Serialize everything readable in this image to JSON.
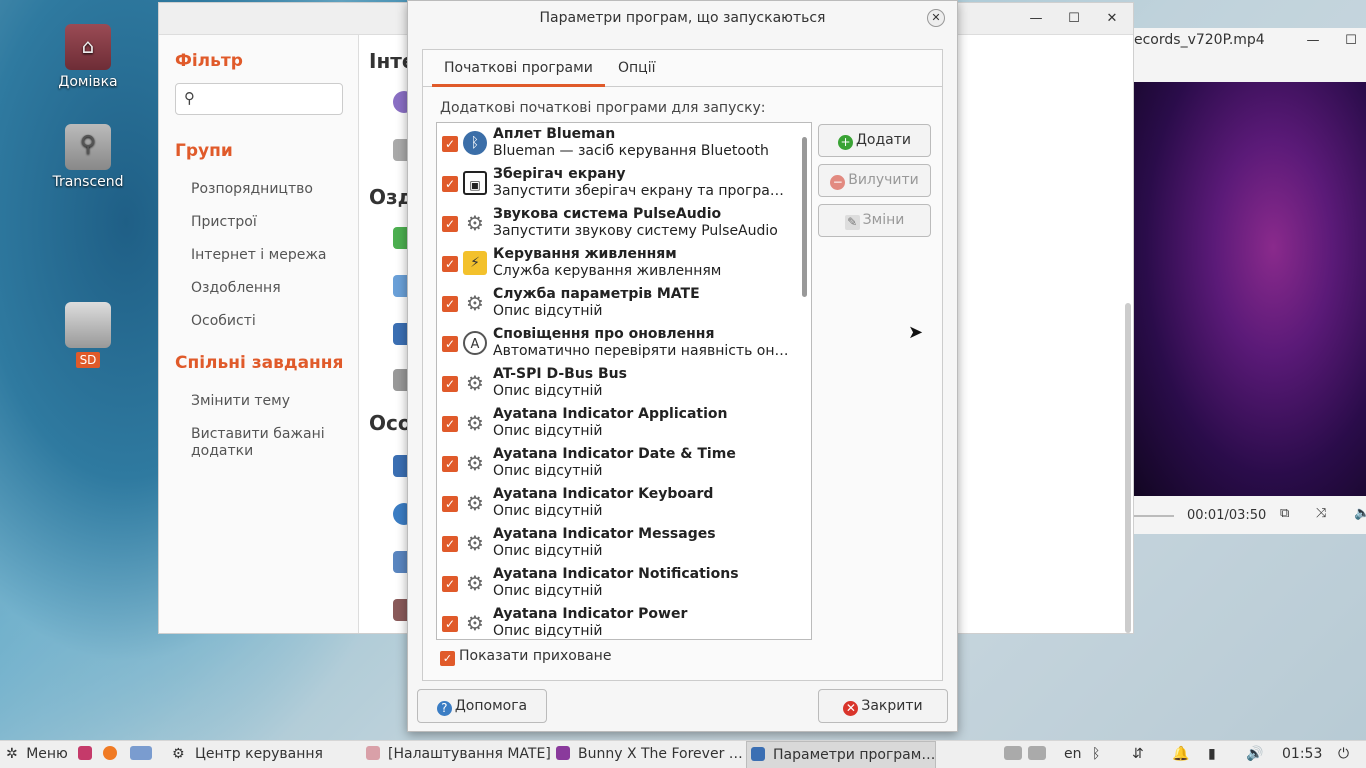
{
  "desktop": {
    "icons": [
      {
        "label": "Домівка"
      },
      {
        "label": "Transcend"
      },
      {
        "label": "SD"
      }
    ]
  },
  "control_center": {
    "filter_heading": "Фільтр",
    "groups_heading": "Групи",
    "groups": [
      "Розпорядництво",
      "Пристрої",
      "Інтернет і мережа",
      "Оздоблення",
      "Особисті"
    ],
    "tasks_heading": "Спільні завдання",
    "tasks": [
      "Змінити тему",
      "Виставити бажані додатки"
    ],
    "sections": [
      "Інте",
      "Озд",
      "Осо"
    ]
  },
  "video_player": {
    "title": "ecords_v720P.mp4",
    "time": "00:01/03:50"
  },
  "dialog": {
    "title": "Параметри програм, що запускаються",
    "tabs": [
      "Початкові програми",
      "Опції"
    ],
    "list_label": "Додаткові початкові програми для запуску:",
    "items": [
      {
        "name": "Аплет Blueman",
        "desc": "Blueman — засіб керування Bluetooth",
        "icon": "bluetooth-icon",
        "checked": true
      },
      {
        "name": "Зберігач екрану",
        "desc": "Запустити зберігач екрану та програму б…",
        "icon": "screensaver-icon",
        "checked": true
      },
      {
        "name": "Звукова система PulseAudio",
        "desc": "Запустити звукову систему PulseAudio",
        "icon": "gears-icon",
        "checked": true
      },
      {
        "name": "Керування живленням",
        "desc": "Служба керування живленням",
        "icon": "power-icon",
        "checked": true
      },
      {
        "name": "Служба параметрів MATE",
        "desc": "Опис відсутній",
        "icon": "gears-icon",
        "checked": true
      },
      {
        "name": "Сповіщення про оновлення",
        "desc": "Автоматично перевіряти наявність онов…",
        "icon": "update-icon",
        "checked": true
      },
      {
        "name": "AT-SPI D-Bus Bus",
        "desc": "Опис відсутній",
        "icon": "gears-icon",
        "checked": true
      },
      {
        "name": "Ayatana Indicator Application",
        "desc": "Опис відсутній",
        "icon": "gears-icon",
        "checked": true
      },
      {
        "name": "Ayatana Indicator Date & Time",
        "desc": "Опис відсутній",
        "icon": "gears-icon",
        "checked": true
      },
      {
        "name": "Ayatana Indicator Keyboard",
        "desc": "Опис відсутній",
        "icon": "gears-icon",
        "checked": true
      },
      {
        "name": "Ayatana Indicator Messages",
        "desc": "Опис відсутній",
        "icon": "gears-icon",
        "checked": true
      },
      {
        "name": "Ayatana Indicator Notifications",
        "desc": "Опис відсутній",
        "icon": "gears-icon",
        "checked": true
      },
      {
        "name": "Ayatana Indicator Power",
        "desc": "Опис відсутній",
        "icon": "gears-icon",
        "checked": true
      }
    ],
    "buttons": {
      "add": "Додати",
      "remove": "Вилучити",
      "edit": "Зміни"
    },
    "show_hidden": "Показати приховане",
    "help": "Допомога",
    "close": "Закрити"
  },
  "panel": {
    "menu": "Меню",
    "tasks": [
      "Центр керування",
      "[Налаштування MATE]",
      "Bunny X The Forever …",
      "Параметри програм…"
    ],
    "lang": "en",
    "clock": "01:53"
  },
  "colors": {
    "accent": "#e05a2a",
    "add": "#3aa335",
    "remove": "#e05a2a",
    "help": "#3b7dc4",
    "close": "#d9342b"
  }
}
